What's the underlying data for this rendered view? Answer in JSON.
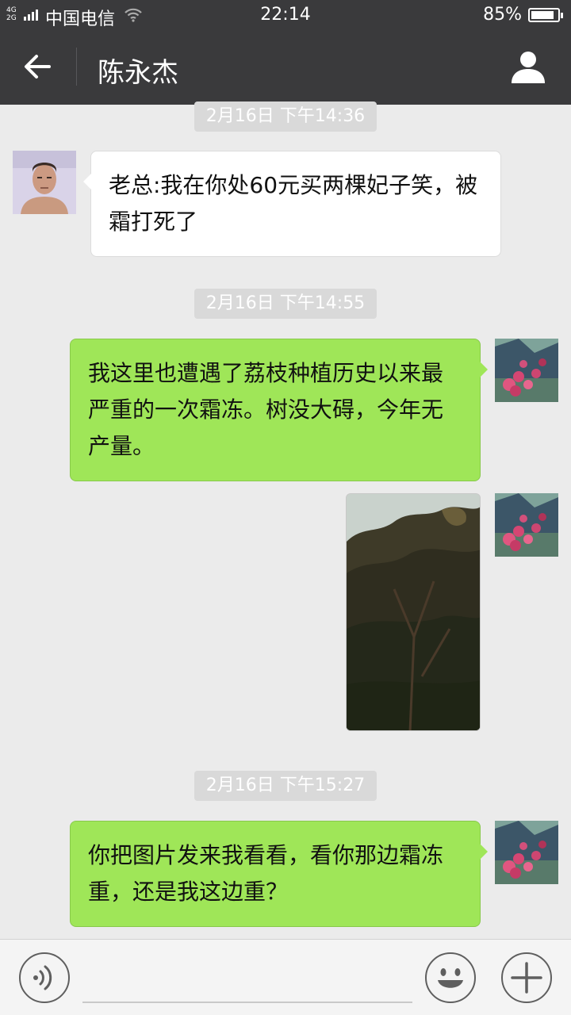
{
  "status_bar": {
    "network_top": "4G",
    "network_bottom": "2G",
    "carrier": "中国电信",
    "time": "22:14",
    "battery": "85%",
    "battery_level": 0.85,
    "icons": [
      "signal-icon",
      "wifi-icon",
      "battery-icon"
    ]
  },
  "header": {
    "title": "陈永杰",
    "back_icon": "arrow-left-icon",
    "profile_icon": "person-icon"
  },
  "messages": [
    {
      "type": "timestamp",
      "text": "2月16日 下午14:36"
    },
    {
      "type": "text",
      "side": "left",
      "text": "老总:我在你处60元买两棵妃子笑，被霜打死了"
    },
    {
      "type": "timestamp",
      "text": "2月16日 下午14:55"
    },
    {
      "type": "text",
      "side": "right",
      "text": "我这里也遭遇了荔枝种植历史以来最严重的一次霜冻。树没大碍，今年无产量。"
    },
    {
      "type": "image",
      "side": "right",
      "content": "lychee tree photo"
    },
    {
      "type": "timestamp",
      "text": "2月16日 下午15:27"
    },
    {
      "type": "text",
      "side": "right",
      "text": "你把图片发来我看看，看你那边霜冻重，还是我这边重？"
    }
  ],
  "input_bar": {
    "voice_icon": "voice-icon",
    "emoji_icon": "smiley-icon",
    "plus_icon": "plus-icon"
  },
  "colors": {
    "header_bg": "#3a3a3c",
    "chat_bg": "#ebebeb",
    "sent_bubble": "#9fe658",
    "received_bubble": "#ffffff"
  }
}
